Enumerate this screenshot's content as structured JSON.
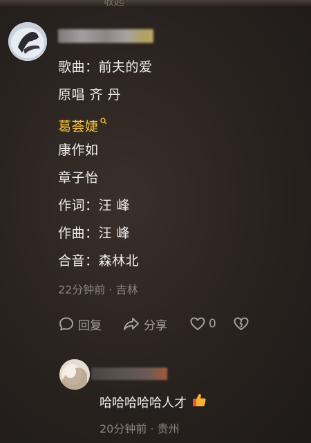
{
  "top_text": "收起",
  "comment": {
    "lines": [
      "歌曲：前夫的爱",
      "原唱 齐 丹",
      "葛荟婕",
      "康作如",
      "章子怡",
      "作词：汪 峰",
      "作曲：汪 峰",
      "合音：森林北"
    ],
    "highlight_index": 2,
    "meta": "22分钟前 · 吉林",
    "actions": {
      "reply_label": "回复",
      "share_label": "分享",
      "like_count": "0"
    }
  },
  "reply": {
    "text": "哈哈哈哈哈人才",
    "meta": "20分钟前 · 贵州"
  },
  "icons": {
    "reply": "speech-bubble-icon",
    "share": "share-arrow-icon",
    "like": "heart-icon",
    "dislike": "broken-heart-icon",
    "search": "search-icon",
    "thumbs_up": "thumbs-up-emoji"
  },
  "colors": {
    "highlight": "#f4c23a",
    "meta": "#8b8580"
  }
}
